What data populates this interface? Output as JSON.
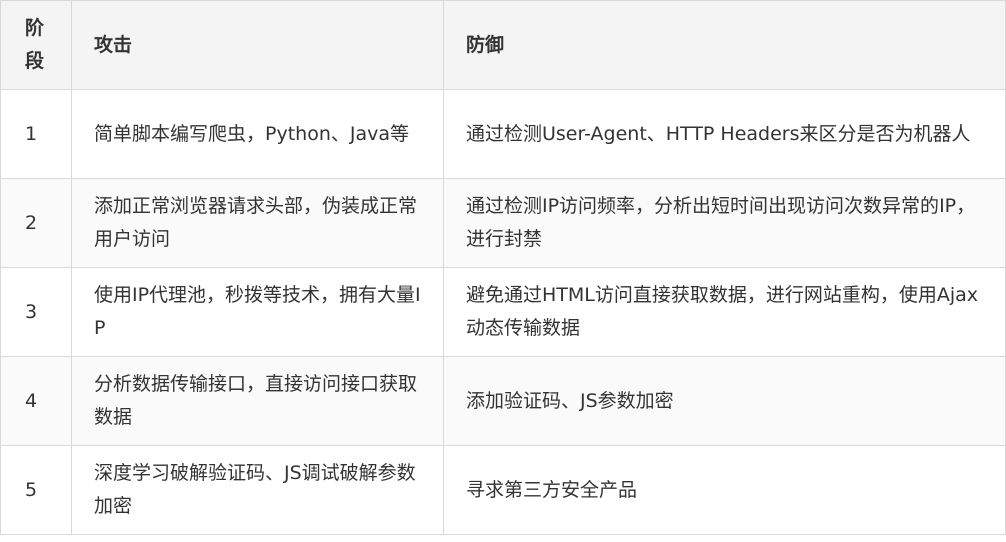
{
  "table": {
    "headers": {
      "stage": "阶段",
      "attack": "攻击",
      "defense": "防御"
    },
    "rows": [
      {
        "stage": "1",
        "attack": "简单脚本编写爬虫，Python、Java等",
        "defense": "通过检测User-Agent、HTTP Headers来区分是否为机器人"
      },
      {
        "stage": "2",
        "attack": "添加正常浏览器请求头部，伪装成正常用户访问",
        "defense": "通过检测IP访问频率，分析出短时间出现访问次数异常的IP，进行封禁"
      },
      {
        "stage": "3",
        "attack": "使用IP代理池，秒拨等技术，拥有大量IP",
        "defense": "避免通过HTML访问直接获取数据，进行网站重构，使用Ajax动态传输数据"
      },
      {
        "stage": "4",
        "attack": "分析数据传输接口，直接访问接口获取数据",
        "defense": "添加验证码、JS参数加密"
      },
      {
        "stage": "5",
        "attack": "深度学习破解验证码、JS调试破解参数加密",
        "defense": "寻求第三方安全产品"
      }
    ]
  }
}
